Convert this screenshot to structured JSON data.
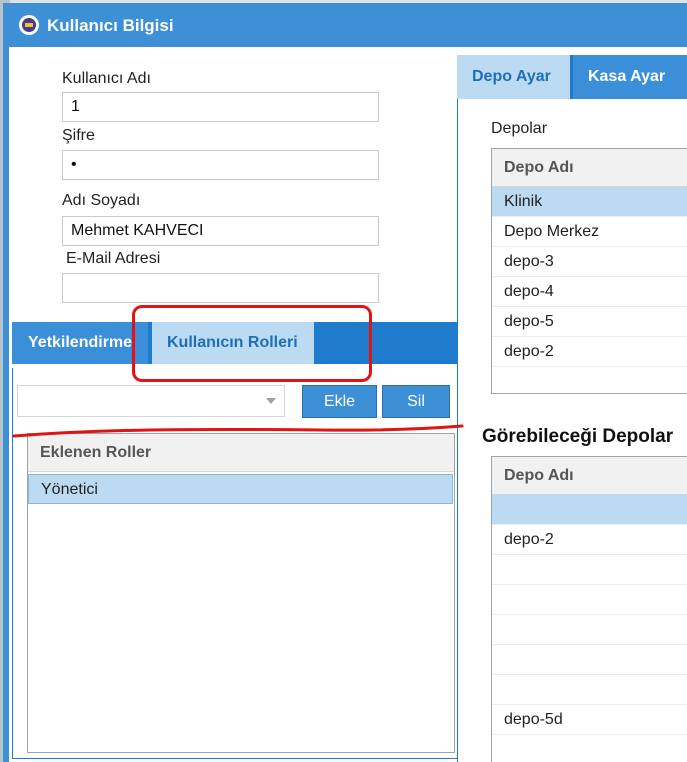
{
  "window": {
    "title": "Kullanıcı Bilgisi"
  },
  "form": {
    "username_label": "Kullanıcı Adı",
    "username_value": "1",
    "password_label": "Şifre",
    "password_value": "•",
    "fullname_label": "Adı Soyadı",
    "fullname_value": "Mehmet KAHVECI",
    "email_label": "E-Mail Adresi",
    "email_value": ""
  },
  "left_tabs": {
    "tabs": [
      {
        "label": "Yetkilendirme",
        "active": false
      },
      {
        "label": "Kullanıcın Rolleri",
        "active": true
      }
    ],
    "combo_value": "",
    "add_label": "Ekle",
    "delete_label": "Sil",
    "roles_grid": {
      "header": "Eklenen Roller",
      "rows": [
        "Yönetici"
      ],
      "selected_index": 0
    }
  },
  "right_tabs": {
    "tabs": [
      {
        "label": "Depo Ayar",
        "active": true
      },
      {
        "label": "Kasa Ayar",
        "active": false
      }
    ],
    "depots_label": "Depolar",
    "depots_grid": {
      "header": "Depo Adı",
      "rows": [
        "Klinik",
        "Depo Merkez",
        "depo-3",
        "depo-4",
        "depo-5",
        "depo-2"
      ],
      "selected_index": 0
    },
    "visible_depots_title": "Görebileceği Depolar",
    "visible_grid": {
      "header": "Depo Adı",
      "rows": [
        "",
        "depo-2",
        "",
        "",
        "",
        "",
        "",
        "depo-5d"
      ],
      "selected_index": 0
    }
  },
  "colors": {
    "titlebar": "#3d8fd6",
    "tab_active": "#bcdaf2",
    "tab_inactive": "#3b8fd8",
    "annotation": "#e01414"
  }
}
